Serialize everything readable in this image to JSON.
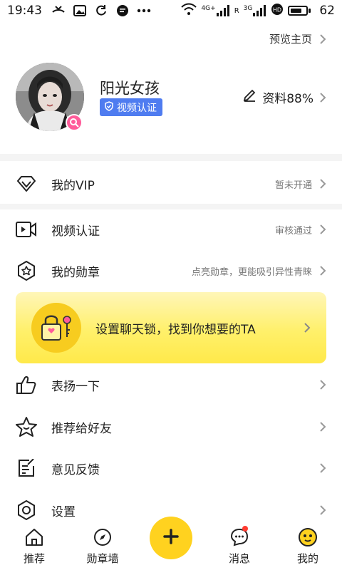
{
  "status_bar": {
    "time": "19:43",
    "battery_percent": "62",
    "network_labels": [
      "4G+",
      "3G"
    ],
    "sim_labels": [
      "R"
    ]
  },
  "header": {
    "preview_label": "预览主页"
  },
  "profile": {
    "name": "阳光女孩",
    "verify_label": "视频认证",
    "edit_label": "资料88%",
    "avatar_icon": "avatar",
    "gender": "female",
    "accent_color": "#4f7cf0"
  },
  "menu": {
    "vip": {
      "label": "我的VIP",
      "note": "暂未开通",
      "icon": "diamond-icon"
    },
    "video_verify": {
      "label": "视频认证",
      "note": "审核通过",
      "icon": "video-camera-icon"
    },
    "medals": {
      "label": "我的勋章",
      "note": "点亮勋章，更能吸引异性青睐",
      "icon": "medal-star-icon"
    },
    "praise": {
      "label": "表扬一下",
      "icon": "thumbs-up-icon"
    },
    "recommend": {
      "label": "推荐给好友",
      "icon": "star-smile-icon"
    },
    "feedback": {
      "label": "意见反馈",
      "icon": "edit-note-icon"
    },
    "settings": {
      "label": "设置",
      "icon": "hexagon-settings-icon"
    }
  },
  "banner": {
    "text": "设置聊天锁，找到你想要的TA",
    "icon": "lock-key-icon",
    "color": "#ffe94a"
  },
  "bottom_nav": {
    "items": [
      {
        "label": "推荐",
        "icon": "home-icon"
      },
      {
        "label": "勋章墙",
        "icon": "compass-icon"
      },
      {
        "label": "消息",
        "icon": "chat-bubble-icon",
        "has_badge": true
      },
      {
        "label": "我的",
        "icon": "face-icon",
        "active": true
      }
    ],
    "fab_icon": "plus-icon",
    "fab_color": "#ffd21f"
  }
}
